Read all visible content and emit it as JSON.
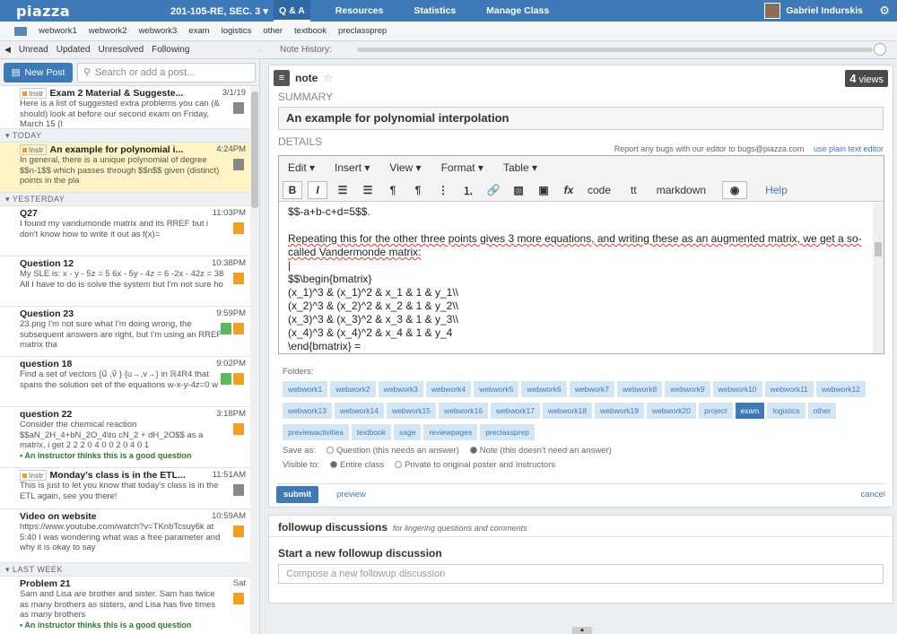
{
  "app": {
    "logo": "piazza",
    "course": "201-105-RE, SEC. 3 ▾",
    "nav": [
      "Q & A",
      "Resources",
      "Statistics",
      "Manage Class"
    ],
    "user": "Gabriel Indurskis"
  },
  "folderbar": [
    "webwork1",
    "webwork2",
    "webwork3",
    "exam",
    "logistics",
    "other",
    "textbook",
    "preclassprep"
  ],
  "filters": [
    "Unread",
    "Updated",
    "Unresolved",
    "Following"
  ],
  "note_history": "Note History:",
  "new_post": "New Post",
  "search_placeholder": "Search or add a post...",
  "sections": {
    "today": "TODAY",
    "yesterday": "YESTERDAY",
    "lastweek": "LAST WEEK"
  },
  "posts_top": [
    {
      "instr": "Instr",
      "title": "Exam 2 Material & Suggeste...",
      "time": "3/1/19",
      "body": "Here is a list of suggested extra problems you can (& should) look at before our second exam on Friday, March 15 (I"
    }
  ],
  "posts_today": [
    {
      "instr": "Instr",
      "title": "An example for polynomial i...",
      "time": "4:24PM",
      "body": "In general, there is a unique polynomial of degree $$n-1$$ which passes through $$n$$ given (distinct) points in the pla"
    }
  ],
  "posts_yesterday": [
    {
      "title": "Q27",
      "time": "11:03PM",
      "body": "I found my vandumonde matrix and its RREF but i don't know how to write it out as f(x)="
    },
    {
      "title": "Question 12",
      "time": "10:38PM",
      "body": "My SLE is: x - y - 5z = 5 6x - 5y - 4z = 6 -2x - 42z = 38 All I have to do is solve the system but I'm not sure ho"
    },
    {
      "title": "Question 23",
      "time": "9:59PM",
      "body": "23.png I'm not sure what I'm doing wrong, the subsequent answers are right, but I'm using an RREF matrix tha"
    },
    {
      "title": "question 18",
      "time": "9:02PM",
      "body": "Find a set of vectors {u⃗ ,v⃗ } {u→,v→} in ℝ4R4 that spans the solution set of the equations w-x-y-4z=0 w"
    },
    {
      "title": "question 22",
      "time": "3:18PM",
      "body": "Consider the chemical reaction $$aN_2H_4+bN_2O_4\\to cN_2 + dH_2O$$ as a matrix, i get 2 2 2 0 4 0 0 2 0 4 0 1",
      "good": "An instructor thinks this is a good question"
    },
    {
      "instr": "Instr",
      "title": "Monday's class is in the ETL...",
      "time": "11:51AM",
      "body": "This is just to let you know that today's class is in the ETL again, see you there!"
    },
    {
      "title": "Video on website",
      "time": "10:59AM",
      "body": "https://www.youtube.com/watch?v=TKnbTcsuy6k at 5:40 I was wondering what was a free parameter and why it is okay to say"
    }
  ],
  "posts_lastweek": [
    {
      "title": "Problem 21",
      "time": "Sat",
      "body": "Sam and Lisa are brother and sister. Sam has twice as many brothers as sisters, and Lisa has five times as many brothers",
      "good": "An instructor thinks this is a good question"
    }
  ],
  "note": {
    "type": "note",
    "views": "4",
    "views_label": "views",
    "summary_label": "SUMMARY",
    "summary": "An example for polynomial interpolation",
    "details_label": "DETAILS",
    "bug_text": "Report any bugs with our editor to bugs@piazza.com",
    "plain_link": "use plain text editor"
  },
  "editor": {
    "menus": [
      "Edit ▾",
      "Insert ▾",
      "View ▾",
      "Format ▾",
      "Table ▾"
    ],
    "text_tools": [
      "code",
      "tt",
      "markdown"
    ],
    "help": "Help",
    "lines": [
      "$$-a+b-c+d=5$$.",
      "",
      "Repeating this for the other three points gives 3 more equations, and writing these as an augmented matrix, we get a so-called Vandermonde matrix:",
      "|",
      "$$\\begin{bmatrix}",
      "(x_1)^3 & (x_1)^2 & x_1 & 1 & y_1\\\\",
      "(x_2)^3 & (x_2)^2 & x_2 & 1 & y_2\\\\",
      "(x_3)^3 & (x_3)^2 & x_3 & 1 & y_3\\\\",
      "(x_4)^3 & (x_4)^2 & x_4 & 1 & y_4",
      "\\end{bmatrix} ="
    ]
  },
  "folders_label": "Folders:",
  "folders": [
    "webwork1",
    "webwork2",
    "webwork3",
    "webwork4",
    "webwork5",
    "webwork6",
    "webwork7",
    "webwork8",
    "webwork9",
    "webwork10",
    "webwork11",
    "webwork12",
    "webwork13",
    "webwork14",
    "webwork15",
    "webwork16",
    "webwork17",
    "webwork18",
    "webwork19",
    "webwork20",
    "project",
    "exam",
    "logistics",
    "other",
    "previewactivities",
    "textbook",
    "sage",
    "reviewpages",
    "preclassprep"
  ],
  "saveas": {
    "label": "Save as:",
    "q": "Question (this needs an answer)",
    "n": "Note (this doesn't need an answer)",
    "vis_label": "Visible to:",
    "entire": "Entire class",
    "private": "Private to original poster and Instructors"
  },
  "actions": {
    "submit": "submit",
    "preview": "preview",
    "cancel": "cancel"
  },
  "followup": {
    "title": "followup discussions",
    "sub": "for lingering questions and comments",
    "start": "Start a new followup discussion",
    "placeholder": "Compose a new followup discussion"
  }
}
